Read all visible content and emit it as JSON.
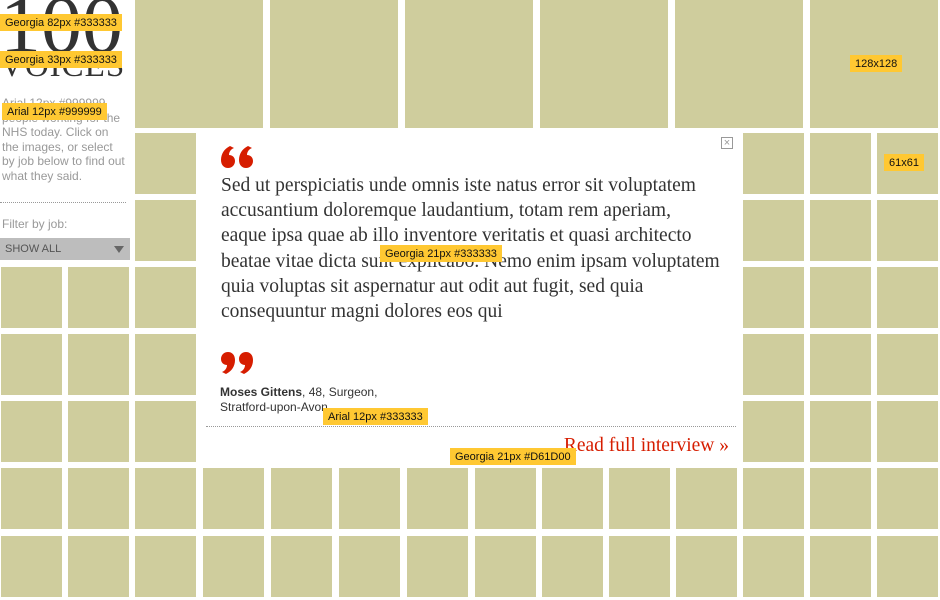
{
  "sidebar": {
    "title_big": "100",
    "title_small": "VOICES",
    "intro_text": "Arial 12px #999999 people working for the NHS today. Click on the images, or select by job below to find out what they said.",
    "filter_label": "Filter by job:",
    "filter_select": {
      "selected": "SHOW ALL"
    }
  },
  "modal": {
    "close_icon": "close-icon",
    "quote_text": "Sed ut perspiciatis unde omnis iste natus error sit voluptatem accusantium doloremque laudantium, totam rem aperiam, eaque ipsa quae ab illo inventore veritatis et quasi architecto beatae vitae dicta sunt explicabo. Nemo enim ipsam voluptatem quia voluptas sit aspernatur aut odit aut fugit, sed quia consequuntur magni dolores eos qui",
    "author_name": "Moses Gittens",
    "author_details": ", 48, Surgeon,",
    "author_location": "Stratford-upon-Avon",
    "read_more": "Read full interview",
    "read_more_arrow": "»",
    "quote_color": "#d61d00"
  },
  "annotations": {
    "title_big": "Georgia 82px #333333",
    "title_small": "Georgia 33px #333333",
    "intro": "Arial 12px #999999",
    "large_tile": "128x128",
    "small_tile": "61x61",
    "quote_text": "Georgia 21px #333333",
    "author": "Arial 12px #333333",
    "read_more": "Georgia 21px #D61D00"
  },
  "colors": {
    "tile": "#cfcd9d",
    "accent": "#d61d00",
    "text": "#333333",
    "muted": "#999999",
    "annotation": "#ffc832"
  }
}
